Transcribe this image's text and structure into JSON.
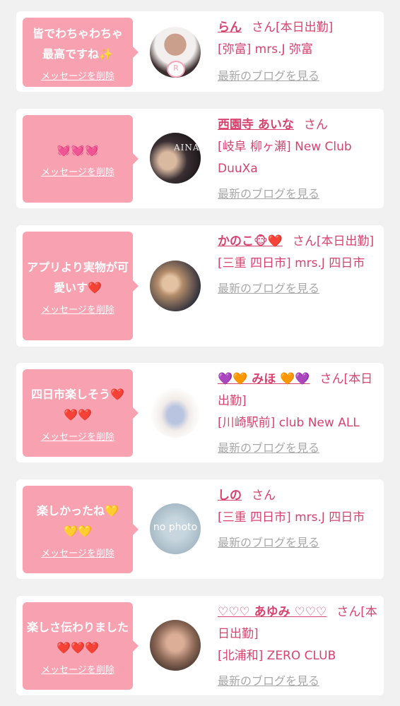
{
  "cards": [
    {
      "message": "皆でわちゃわちゃ最高ですね✨",
      "delete_label": "メッセージを削除",
      "name": "らん",
      "san": "さん[本日出勤]",
      "location": "[弥富] mrs.J 弥富",
      "blog_label": "最新のブログを見る",
      "avatar_badge": "R"
    },
    {
      "message": "💓💓💓",
      "delete_label": "メッセージを削除",
      "name": "西園寺 あいな",
      "san": "さん",
      "location": "[岐阜 柳ヶ瀬] New Club DuuXa",
      "blog_label": "最新のブログを見る",
      "avatar_badge": "AINA"
    },
    {
      "message": "アプリより実物が可愛いす❤️",
      "delete_label": "メッセージを削除",
      "name": "かのこ🐵❤️",
      "san": "さん[本日出勤]",
      "location": "[三重 四日市] mrs.J 四日市",
      "blog_label": "最新のブログを見る"
    },
    {
      "message": "四日市楽しそう❤️❤️❤️",
      "delete_label": "メッセージを削除",
      "name": "💜🧡 みほ 🧡💜",
      "san": "さん[本日出勤]",
      "location": "[川崎駅前] club New ALL",
      "blog_label": "最新のブログを見る"
    },
    {
      "message": "楽しかったね💛💛💛",
      "delete_label": "メッセージを削除",
      "name": "しの",
      "san": "さん",
      "location": "[三重 四日市] mrs.J 四日市",
      "blog_label": "最新のブログを見る",
      "avatar_badge": "no photo"
    },
    {
      "message": "楽しさ伝わりました❤️❤️❤️",
      "delete_label": "メッセージを削除",
      "name": "♡♡♡ あゆみ ♡♡♡",
      "san": "さん[本日出勤]",
      "location": "[北浦和] ZERO CLUB",
      "blog_label": "最新のブログを見る"
    }
  ]
}
